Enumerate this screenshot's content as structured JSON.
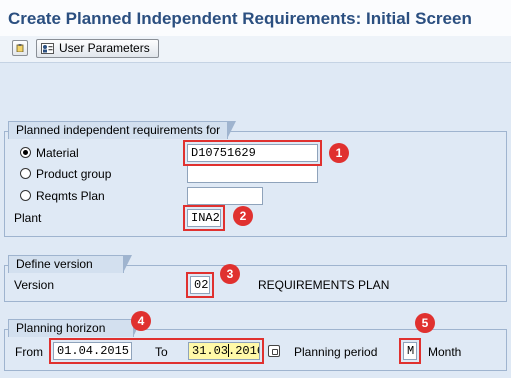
{
  "title": "Create Planned Independent Requirements: Initial Screen",
  "toolbar": {
    "user_parameters_label": "User Parameters",
    "icons": [
      "clipboard-icon",
      "user-parameters-icon"
    ]
  },
  "pir_group": {
    "title": "Planned independent requirements for",
    "options": [
      {
        "label": "Material",
        "value": "D10751629",
        "selected": true
      },
      {
        "label": "Product group",
        "value": "",
        "selected": false
      },
      {
        "label": "Reqmts Plan",
        "value": "",
        "selected": false
      }
    ],
    "plant_label": "Plant",
    "plant_value": "INA2"
  },
  "version_group": {
    "title": "Define version",
    "version_label": "Version",
    "version_value": "02",
    "version_desc": "REQUIREMENTS PLAN"
  },
  "horizon_group": {
    "title": "Planning horizon",
    "from_label": "From",
    "from_value": "01.04.2015",
    "to_label": "To",
    "to_value": "31.03.2016",
    "period_label": "Planning period",
    "period_value": "M",
    "period_desc": "Month"
  },
  "callouts": [
    "1",
    "2",
    "3",
    "4",
    "5"
  ],
  "colors": {
    "title": "#2b4f80",
    "background": "#dfe9f5",
    "highlight": "#e0312f",
    "date_field": "#fff9a8"
  }
}
